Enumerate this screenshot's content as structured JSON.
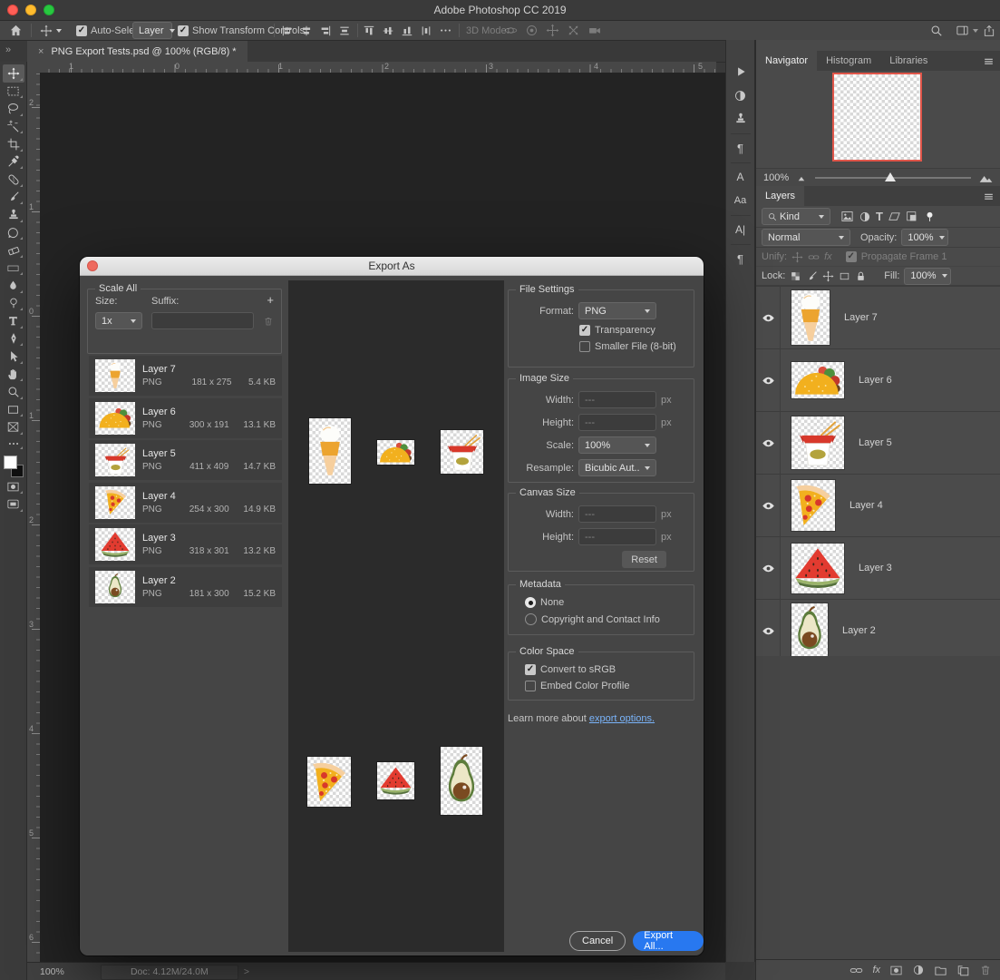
{
  "window": {
    "title": "Adobe Photoshop CC 2019"
  },
  "toolbar": {
    "selected_tool": "move-tool"
  },
  "options_bar": {
    "auto_select_label": "Auto-Select:",
    "auto_select_value": "Layer",
    "show_transform_label": "Show Transform Controls",
    "mode_3d_label": "3D Mode:"
  },
  "tab_bar": {
    "document_tab": "PNG Export Tests.psd @ 100% (RGB/8) *"
  },
  "rulers": {
    "horizontal": [
      "1",
      "0",
      "1",
      "2",
      "3",
      "4",
      "5"
    ],
    "vertical": [
      "2",
      "1",
      "0",
      "1",
      "2",
      "3",
      "4",
      "5",
      "6"
    ]
  },
  "export_dialog": {
    "title": "Export As",
    "scale_all": {
      "legend": "Scale All",
      "size_label": "Size:",
      "size_value": "1x",
      "suffix_label": "Suffix:",
      "suffix_value": "",
      "add_button": "+"
    },
    "layer_list": [
      {
        "name": "Layer 7",
        "format": "PNG",
        "dimensions": "181 x 275",
        "size": "5.4 KB",
        "icon": "ice-cream-icon"
      },
      {
        "name": "Layer 6",
        "format": "PNG",
        "dimensions": "300 x 191",
        "size": "13.1 KB",
        "icon": "taco-icon"
      },
      {
        "name": "Layer 5",
        "format": "PNG",
        "dimensions": "411 x 409",
        "size": "14.7 KB",
        "icon": "noodle-box-icon"
      },
      {
        "name": "Layer 4",
        "format": "PNG",
        "dimensions": "254 x 300",
        "size": "14.9 KB",
        "icon": "pizza-icon"
      },
      {
        "name": "Layer 3",
        "format": "PNG",
        "dimensions": "318 x 301",
        "size": "13.2 KB",
        "icon": "watermelon-icon"
      },
      {
        "name": "Layer 2",
        "format": "PNG",
        "dimensions": "181 x 300",
        "size": "15.2 KB",
        "icon": "avocado-icon"
      }
    ],
    "file_settings": {
      "legend": "File Settings",
      "format_label": "Format:",
      "format_value": "PNG",
      "transparency_label": "Transparency",
      "transparency_checked": true,
      "smaller_file_label": "Smaller File (8-bit)",
      "smaller_file_checked": false
    },
    "image_size": {
      "legend": "Image Size",
      "width_label": "Width:",
      "width_value": "---",
      "height_label": "Height:",
      "height_value": "---",
      "unit": "px",
      "scale_label": "Scale:",
      "scale_value": "100%",
      "resample_label": "Resample:",
      "resample_value": "Bicubic Aut..."
    },
    "canvas_size": {
      "legend": "Canvas Size",
      "width_label": "Width:",
      "width_value": "---",
      "height_label": "Height:",
      "height_value": "---",
      "unit": "px",
      "reset_button": "Reset"
    },
    "metadata": {
      "legend": "Metadata",
      "options": [
        {
          "label": "None",
          "selected": true
        },
        {
          "label": "Copyright and Contact Info",
          "selected": false
        }
      ]
    },
    "color_space": {
      "legend": "Color Space",
      "convert_label": "Convert to sRGB",
      "convert_checked": true,
      "embed_label": "Embed Color Profile",
      "embed_checked": false
    },
    "learn_more": {
      "prefix": "Learn more about",
      "link": "export options."
    },
    "cancel_button": "Cancel",
    "export_all_button": "Export All..."
  },
  "navigator_panel": {
    "tabs": [
      "Navigator",
      "Histogram",
      "Libraries"
    ],
    "zoom_value": "100%"
  },
  "layers_panel": {
    "tab": "Layers",
    "filter_kind": "Kind",
    "blend_mode": "Normal",
    "opacity_label": "Opacity:",
    "opacity_value": "100%",
    "unify_label": "Unify:",
    "propagate_label": "Propagate Frame 1",
    "lock_label": "Lock:",
    "fill_label": "Fill:",
    "fill_value": "100%",
    "fx_label": "fx",
    "layers": [
      {
        "name": "Layer 7",
        "visible": true,
        "icon": "ice-cream-icon"
      },
      {
        "name": "Layer 6",
        "visible": true,
        "icon": "taco-icon"
      },
      {
        "name": "Layer 5",
        "visible": true,
        "icon": "noodle-box-icon"
      },
      {
        "name": "Layer 4",
        "visible": true,
        "icon": "pizza-icon"
      },
      {
        "name": "Layer 3",
        "visible": true,
        "icon": "watermelon-icon"
      },
      {
        "name": "Layer 2",
        "visible": true,
        "icon": "avocado-icon"
      }
    ]
  },
  "status_bar": {
    "zoom": "100%",
    "doc_info": "Doc: 4.12M/24.0M"
  },
  "colors": {
    "accent_blue": "#2878f0",
    "link_blue": "#7ab4fa",
    "navigator_border_red": "#e0564a",
    "canvas_bg": "#232323"
  }
}
